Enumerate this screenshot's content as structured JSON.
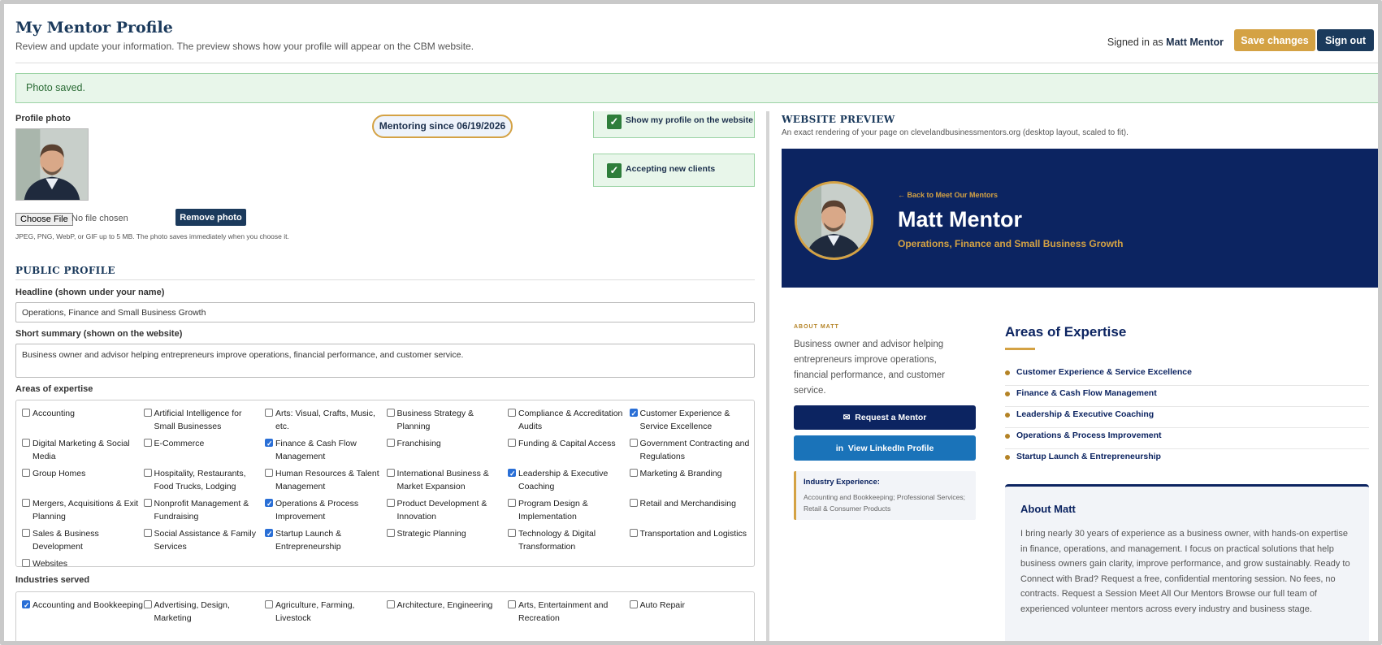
{
  "header": {
    "title": "My Mentor Profile",
    "subtitle": "Review and update your information. The preview shows how your profile will appear on the CBM website.",
    "signed_in_prefix": "Signed in as",
    "signed_in_name": "Matt Mentor",
    "save_label": "Save changes",
    "signout_label": "Sign out"
  },
  "alert": "Photo saved.",
  "photo": {
    "label": "Profile photo",
    "choose_label": "Choose File",
    "no_file": "No file chosen",
    "remove_label": "Remove photo",
    "note": "JPEG, PNG, WebP, or GIF up to 5 MB. The photo saves immediately when you choose it."
  },
  "mentoring_since": "Mentoring since 06/19/2026",
  "toggles": {
    "show_profile": "Show my profile on the website",
    "accepting": "Accepting new clients"
  },
  "public_profile": {
    "section_title": "PUBLIC PROFILE",
    "headline_label": "Headline (shown under your name)",
    "headline_value": "Operations, Finance and Small Business Growth",
    "summary_label": "Short summary (shown on the website)",
    "summary_value": "Business owner and advisor helping entrepreneurs improve operations, financial performance, and customer service."
  },
  "expertise": {
    "label": "Areas of expertise",
    "items": [
      {
        "text": "Accounting",
        "checked": false
      },
      {
        "text": "Artificial Intelligence for Small Businesses",
        "checked": false
      },
      {
        "text": "Arts: Visual, Crafts, Music, etc.",
        "checked": false
      },
      {
        "text": "Business Strategy & Planning",
        "checked": false
      },
      {
        "text": "Compliance & Accreditation Audits",
        "checked": false
      },
      {
        "text": "Customer Experience & Service Excellence",
        "checked": true
      },
      {
        "text": "Digital Marketing & Social Media",
        "checked": false
      },
      {
        "text": "E-Commerce",
        "checked": false
      },
      {
        "text": "Finance & Cash Flow Management",
        "checked": true
      },
      {
        "text": "Franchising",
        "checked": false
      },
      {
        "text": "Funding & Capital Access",
        "checked": false
      },
      {
        "text": "Government Contracting and Regulations",
        "checked": false
      },
      {
        "text": "Group Homes",
        "checked": false
      },
      {
        "text": "Hospitality, Restaurants, Food Trucks, Lodging",
        "checked": false
      },
      {
        "text": "Human Resources & Talent Management",
        "checked": false
      },
      {
        "text": "International Business & Market Expansion",
        "checked": false
      },
      {
        "text": "Leadership & Executive Coaching",
        "checked": true
      },
      {
        "text": "Marketing & Branding",
        "checked": false
      },
      {
        "text": "Mergers, Acquisitions & Exit Planning",
        "checked": false
      },
      {
        "text": "Nonprofit Management & Fundraising",
        "checked": false
      },
      {
        "text": "Operations & Process Improvement",
        "checked": true
      },
      {
        "text": "Product Development & Innovation",
        "checked": false
      },
      {
        "text": "Program Design & Implementation",
        "checked": false
      },
      {
        "text": "Retail and Merchandising",
        "checked": false
      },
      {
        "text": "Sales & Business Development",
        "checked": false
      },
      {
        "text": "Social Assistance & Family Services",
        "checked": false
      },
      {
        "text": "Startup Launch & Entrepreneurship",
        "checked": true
      },
      {
        "text": "Strategic Planning",
        "checked": false
      },
      {
        "text": "Technology & Digital Transformation",
        "checked": false
      },
      {
        "text": "Transportation and Logistics",
        "checked": false
      },
      {
        "text": "Websites",
        "checked": false
      }
    ]
  },
  "industries": {
    "label": "Industries served",
    "items": [
      {
        "text": "Accounting and Bookkeeping",
        "checked": true
      },
      {
        "text": "Advertising, Design, Marketing",
        "checked": false
      },
      {
        "text": "Agriculture, Farming, Livestock",
        "checked": false
      },
      {
        "text": "Architecture, Engineering",
        "checked": false
      },
      {
        "text": "Arts, Entertainment and Recreation",
        "checked": false
      },
      {
        "text": "Auto Repair",
        "checked": false
      }
    ]
  },
  "preview": {
    "title": "WEBSITE PREVIEW",
    "subtitle": "An exact rendering of your page on clevelandbusinessmentors.org (desktop layout, scaled to fit).",
    "back_link": "← Back to Meet Our Mentors",
    "name": "Matt Mentor",
    "tagline": "Operations, Finance and Small Business Growth",
    "about_kicker": "ABOUT MATT",
    "about_text": "Business owner and advisor helping entrepreneurs improve operations, financial performance, and customer service.",
    "request_label": "Request a Mentor",
    "linkedin_label": "View LinkedIn Profile",
    "industry_title": "Industry Experience:",
    "industry_text": "Accounting and Bookkeeping; Professional Services; Retail & Consumer Products",
    "expertise_title": "Areas of Expertise",
    "expertise_items": [
      "Customer Experience & Service Excellence",
      "Finance & Cash Flow Management",
      "Leadership & Executive Coaching",
      "Operations & Process Improvement",
      "Startup Launch & Entrepreneurship"
    ],
    "about_card_title": "About Matt",
    "about_card_text": "I bring nearly 30 years of experience as a business owner, with hands-on expertise in finance, operations, and management. I focus on practical solutions that help business owners gain clarity, improve performance, and grow sustainably. Ready to Connect with Brad? Request a free, confidential mentoring session. No fees, no contracts. Request a Session Meet All Our Mentors Browse our full team of experienced volunteer mentors across every industry and business stage."
  },
  "icons": {
    "check": "check-icon",
    "mail": "mail-icon",
    "linkedin": "linkedin-icon"
  },
  "colors": {
    "navy": "#0c2461",
    "gold": "#d4a244",
    "linkedin": "#1a73b9",
    "success_bg": "#e8f6ea",
    "success_text": "#2a6b35"
  }
}
